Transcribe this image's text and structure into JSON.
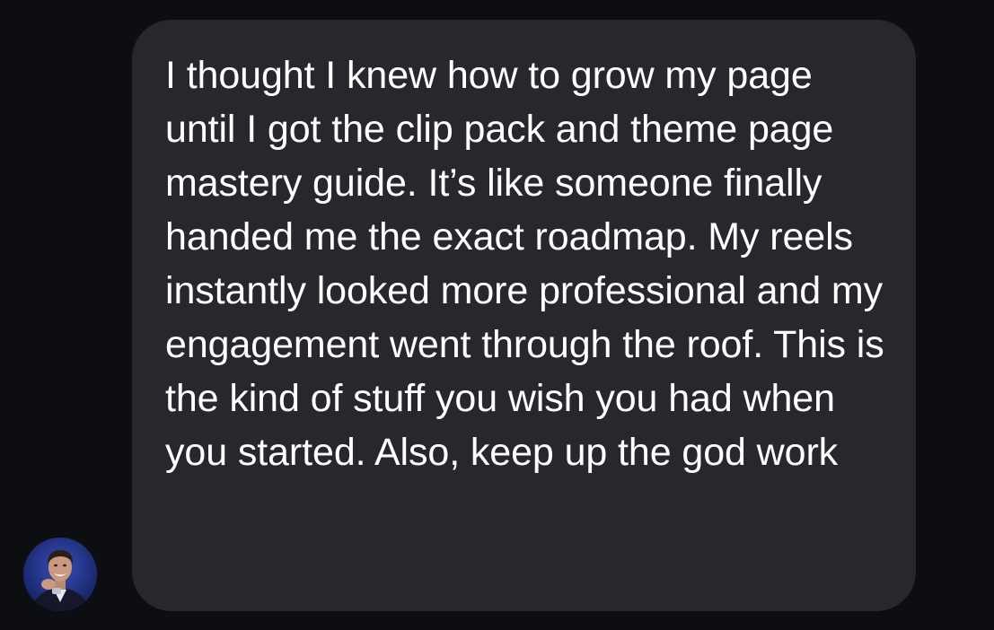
{
  "conversation": {
    "messages": [
      {
        "sender": "incoming",
        "avatar_icon": "profile-photo",
        "text": "I thought I knew how to grow my page until I got the clip pack and theme page mastery guide. It’s like someone finally handed me the exact roadmap. My reels instantly looked more professional and my engagement went through the roof. This is the kind of stuff you wish you had when you started. Also, keep up the god work"
      }
    ]
  },
  "colors": {
    "background": "#0c0e12",
    "bubble": "#26282d",
    "text": "#ffffff"
  }
}
